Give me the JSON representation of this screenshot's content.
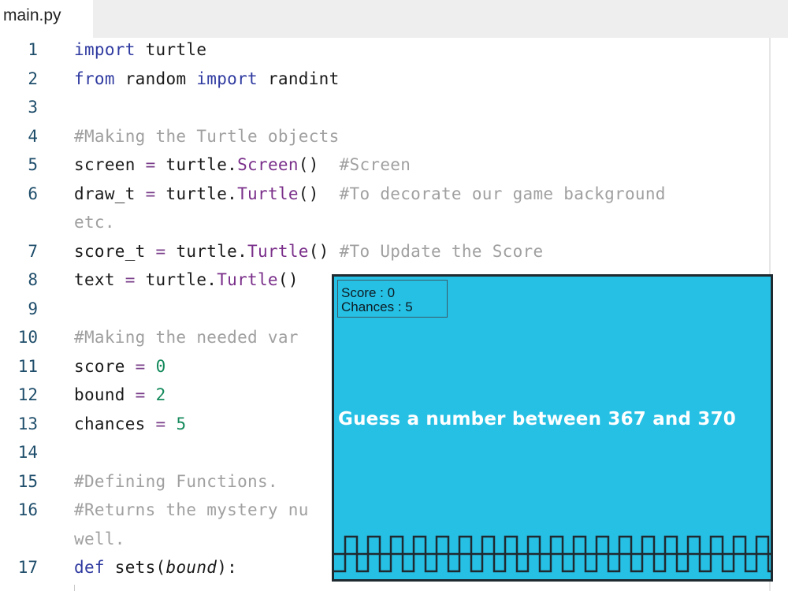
{
  "tabs": [
    {
      "label": "main.py"
    }
  ],
  "editor": {
    "lines": [
      {
        "number": "1",
        "text": "import turtle"
      },
      {
        "number": "2",
        "text": "from random import randint"
      },
      {
        "number": "3",
        "text": ""
      },
      {
        "number": "4",
        "text": "#Making the Turtle objects"
      },
      {
        "number": "5",
        "text": "screen = turtle.Screen()  #Screen"
      },
      {
        "number": "6",
        "text": "draw_t = turtle.Turtle()  #To decorate our game background"
      },
      {
        "number": "",
        "text": "etc."
      },
      {
        "number": "7",
        "text": "score_t = turtle.Turtle() #To Update the Score"
      },
      {
        "number": "8",
        "text": "text = turtle.Turtle()"
      },
      {
        "number": "9",
        "text": ""
      },
      {
        "number": "10",
        "text": "#Making the needed var"
      },
      {
        "number": "11",
        "text": "score = 0"
      },
      {
        "number": "12",
        "text": "bound = 2"
      },
      {
        "number": "13",
        "text": "chances = 5"
      },
      {
        "number": "14",
        "text": ""
      },
      {
        "number": "15",
        "text": "#Defining Functions."
      },
      {
        "number": "16",
        "text": "#Returns the mystery nu"
      },
      {
        "number": "",
        "text": "well."
      },
      {
        "number": "17",
        "text": "def sets(bound):"
      }
    ]
  },
  "game": {
    "score_line": "Score : 0",
    "chances_line": "Chances : 5",
    "prompt": "Guess a number between 367 and 370",
    "colors": {
      "background": "#26c0e5",
      "border": "#1f2a30",
      "text": "#ffffff"
    }
  }
}
